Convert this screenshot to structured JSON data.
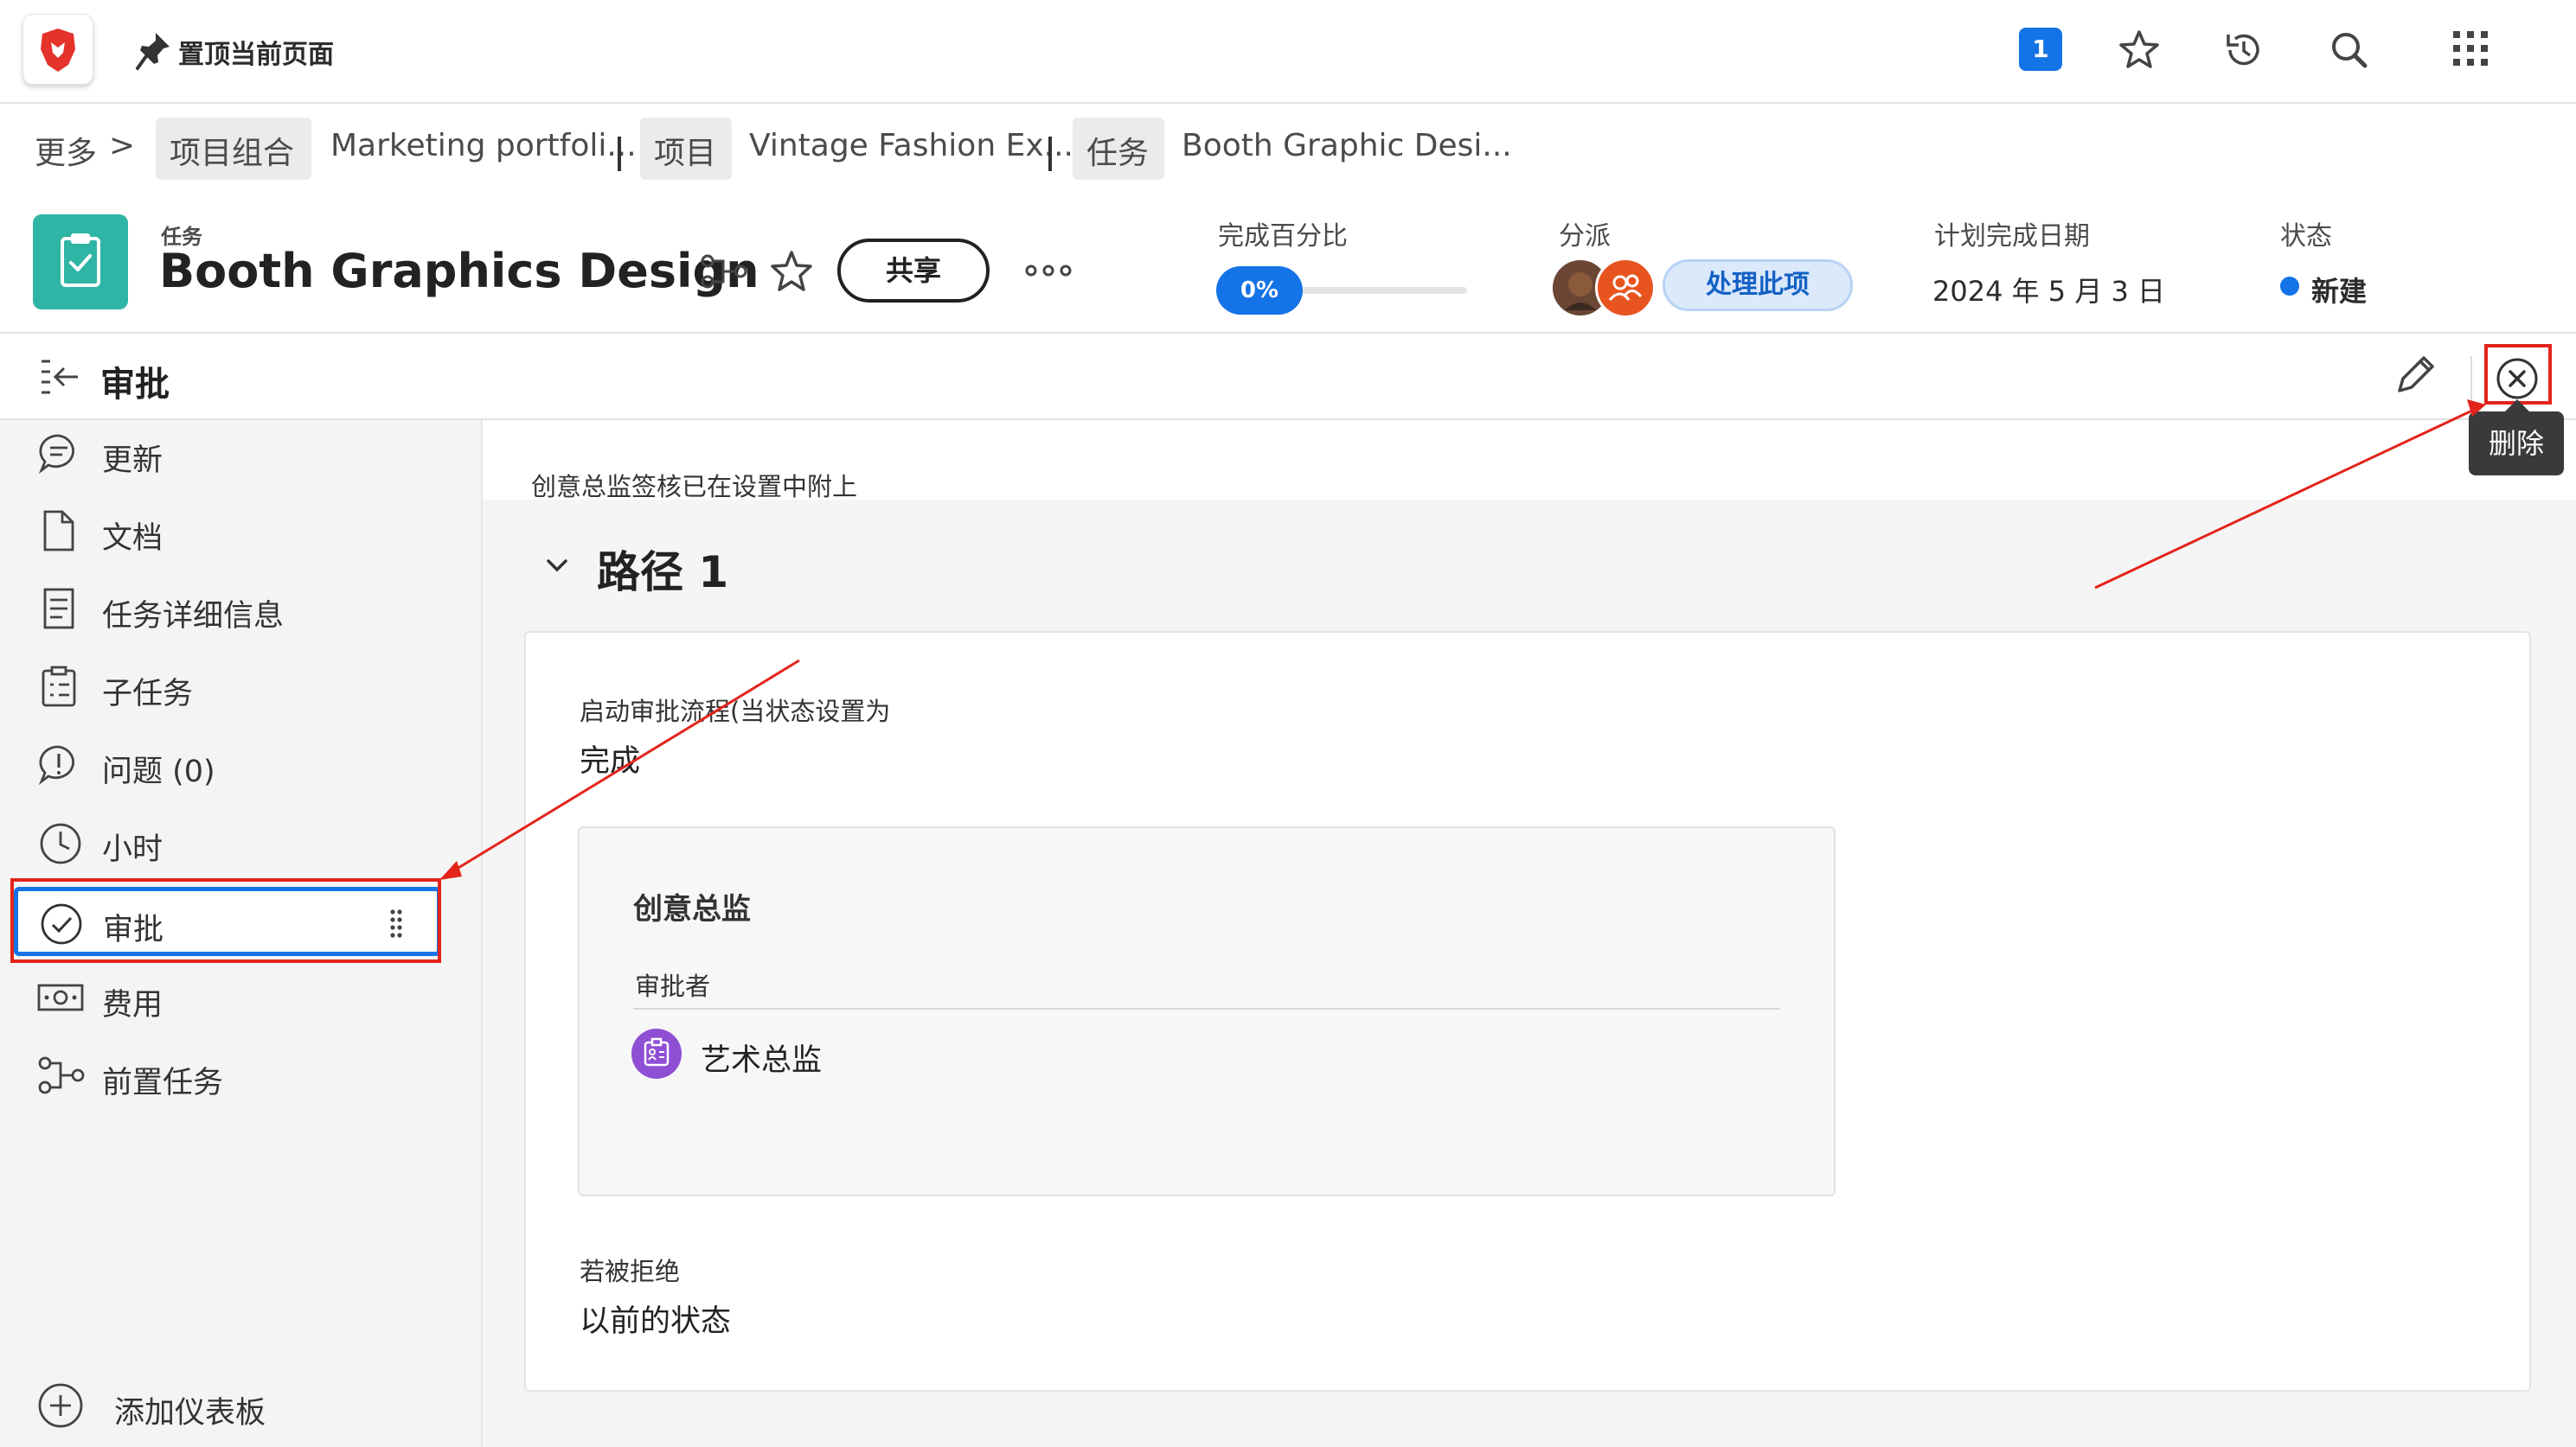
{
  "topbar": {
    "pin_label": "置顶当前页面",
    "notification_count": "1"
  },
  "breadcrumb": {
    "more": "更多",
    "chevron": ">",
    "portfolio_chip": "项目组合",
    "portfolio_name": "Marketing portfoli...",
    "project_chip": "项目",
    "project_name": "Vintage Fashion Ex...",
    "task_chip": "任务",
    "task_name": "Booth Graphic Desi..."
  },
  "header": {
    "object_type": "任务",
    "title": "Booth Graphics Design",
    "share_label": "共享",
    "percent_label": "完成百分比",
    "percent_value": "0%",
    "percent_fraction": 0.0,
    "assign_label": "分派",
    "assign_button": "处理此项",
    "due_label": "计划完成日期",
    "due_value": "2024 年 5 月 3 日",
    "status_label": "状态",
    "status_value": "新建",
    "status_color": "#1473e6"
  },
  "panel": {
    "title": "审批",
    "delete_tooltip": "删除"
  },
  "sidebar": {
    "items": [
      {
        "label": "更新",
        "icon": "comment-icon"
      },
      {
        "label": "文档",
        "icon": "document-icon"
      },
      {
        "label": "任务详细信息",
        "icon": "details-icon"
      },
      {
        "label": "子任务",
        "icon": "subtasks-icon"
      },
      {
        "label": "问题 (0)",
        "icon": "issue-icon"
      },
      {
        "label": "小时",
        "icon": "clock-icon"
      },
      {
        "label": "审批",
        "icon": "approval-check-icon"
      },
      {
        "label": "费用",
        "icon": "money-icon"
      },
      {
        "label": "前置任务",
        "icon": "predecessor-icon"
      }
    ],
    "add_dashboard": "添加仪表板"
  },
  "approval": {
    "note": "创意总监签核已在设置中附上",
    "path_title": "路径 1",
    "start_label": "启动审批流程(当状态设置为",
    "start_value": "完成",
    "stage_title": "创意总监",
    "approver_label": "审批者",
    "approver_name": "艺术总监",
    "rejected_label": "若被拒绝",
    "rejected_value": "以前的状态"
  },
  "colors": {
    "accent": "#1473e6",
    "task_tile": "#2fb5a6",
    "annotation_red": "#e3241b",
    "approver_badge": "#8f4fd4"
  }
}
